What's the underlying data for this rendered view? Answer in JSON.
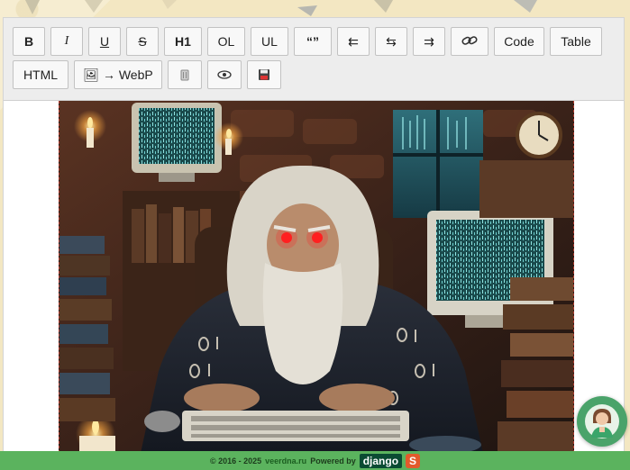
{
  "toolbar": {
    "row1": [
      {
        "name": "bold-button",
        "label": "B"
      },
      {
        "name": "italic-button",
        "label": "I"
      },
      {
        "name": "underline-button",
        "label": "U"
      },
      {
        "name": "strikethrough-button",
        "label": "S"
      },
      {
        "name": "heading1-button",
        "label": "H1"
      },
      {
        "name": "ordered-list-button",
        "label": "OL"
      },
      {
        "name": "unordered-list-button",
        "label": "UL"
      },
      {
        "name": "quote-button",
        "label": "“”"
      },
      {
        "name": "align-left-button",
        "label": "⇇"
      },
      {
        "name": "align-center-button",
        "label": "⇆"
      },
      {
        "name": "align-right-button",
        "label": "⇉"
      },
      {
        "name": "link-button",
        "label": "🔗"
      },
      {
        "name": "code-button",
        "label": "Code"
      },
      {
        "name": "table-button",
        "label": "Table"
      }
    ],
    "row2": [
      {
        "name": "html-button",
        "label": "HTML"
      },
      {
        "name": "image-to-webp-button",
        "label": "🖼 → WebP"
      },
      {
        "name": "trash-button",
        "label": "🗑"
      },
      {
        "name": "preview-button",
        "label": "👁"
      },
      {
        "name": "save-button",
        "label": "💾"
      }
    ]
  },
  "footer": {
    "copyright": "© 2016 - 2025",
    "site": "veerdna.ru",
    "powered_by": "Powered by",
    "framework": "django",
    "s_logo": "S"
  },
  "icons": {
    "avatar": "support-avatar-icon",
    "image": "wizard-programmer-illustration"
  },
  "colors": {
    "toolbar_bg": "#ededed",
    "footer_bg": "#5bb35e",
    "image_border": "#b03a2e",
    "avatar_bg": "#4aa36a"
  }
}
